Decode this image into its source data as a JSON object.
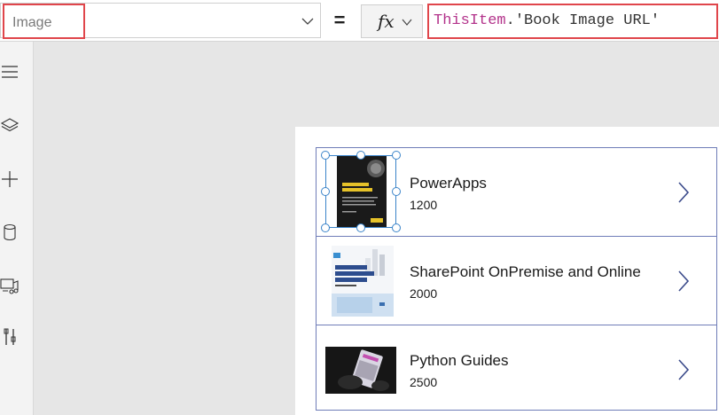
{
  "formula_bar": {
    "property_value": "Image",
    "equals": "=",
    "fx_label": "fx",
    "formula_keyword": "ThisItem",
    "formula_rest": ".'Book Image URL'"
  },
  "left_rail": {
    "icons": [
      "hamburger-icon",
      "layers-icon",
      "plus-icon",
      "database-icon",
      "media-icon",
      "tools-icon"
    ]
  },
  "gallery": {
    "items": [
      {
        "title": "PowerApps",
        "subtitle": "1200",
        "image": "Beginning PowerApps book cover"
      },
      {
        "title": "SharePoint OnPremise and Online",
        "subtitle": "2000",
        "image": "SharePoint Online Modern Experience book cover"
      },
      {
        "title": "Python Guides",
        "subtitle": "2500",
        "image": "tablet photo"
      }
    ]
  },
  "colors": {
    "highlight": "#e0464b",
    "keyword": "#b3338b",
    "gallery_border": "#6f7db8",
    "selection": "#3b84c9"
  }
}
